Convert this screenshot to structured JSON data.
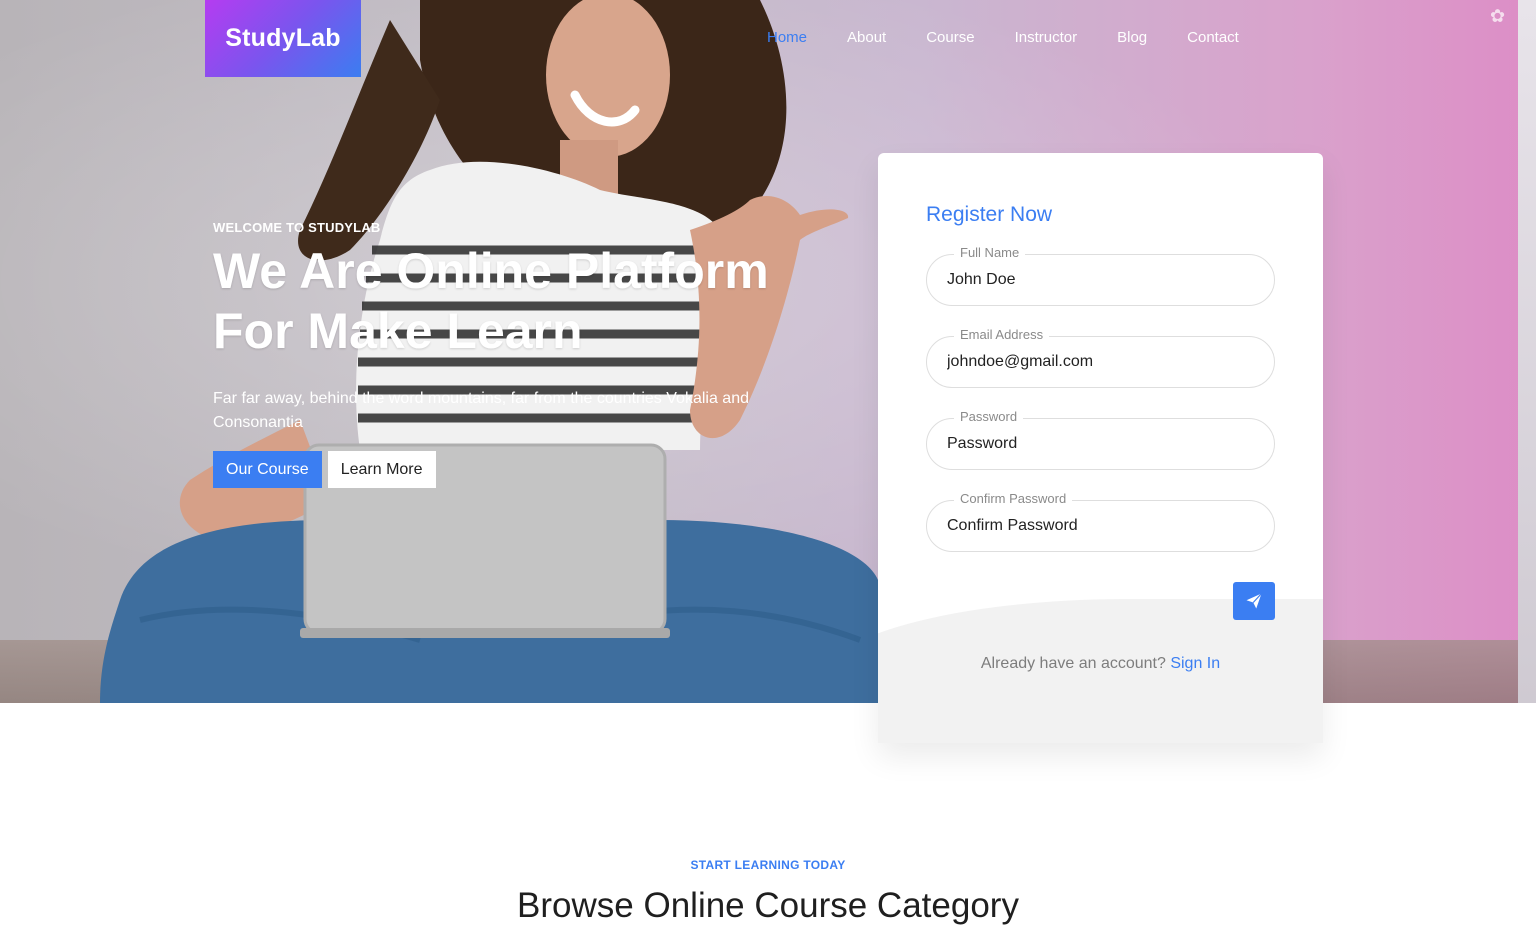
{
  "brand": {
    "logo_text": "StudyLab"
  },
  "nav": {
    "items": [
      {
        "label": "Home",
        "active": true
      },
      {
        "label": "About",
        "active": false
      },
      {
        "label": "Course",
        "active": false
      },
      {
        "label": "Instructor",
        "active": false
      },
      {
        "label": "Blog",
        "active": false
      },
      {
        "label": "Contact",
        "active": false
      }
    ]
  },
  "hero": {
    "eyebrow": "WELCOME TO STUDYLAB",
    "headline_line1": "We Are Online Platform",
    "headline_line2": "For Make Learn",
    "lede": "Far far away, behind the word mountains, far from the countries Vokalia and Consonantia",
    "primary_cta": "Our Course",
    "secondary_cta": "Learn More"
  },
  "register": {
    "title": "Register Now",
    "fields": [
      {
        "label": "Full Name",
        "value": "John Doe"
      },
      {
        "label": "Email Address",
        "value": "johndoe@gmail.com"
      },
      {
        "label": "Password",
        "value": "Password"
      },
      {
        "label": "Confirm Password",
        "value": "Confirm Password"
      }
    ],
    "submit_icon": "paper-plane-icon",
    "signin_prompt": "Already have an account?",
    "signin_link": "Sign In"
  },
  "section": {
    "eyebrow": "START LEARNING TODAY",
    "title": "Browse Online Course Category"
  },
  "colors": {
    "accent": "#3b7ef2",
    "logo_gradient_start": "#b53cf0",
    "logo_gradient_end": "#3b7df0"
  }
}
